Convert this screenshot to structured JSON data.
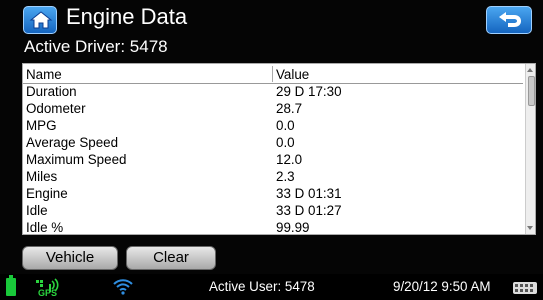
{
  "header": {
    "title": "Engine Data",
    "subtitle": "Active Driver: 5478"
  },
  "table": {
    "columns": [
      "Name",
      "Value"
    ],
    "rows": [
      {
        "name": "Duration",
        "value": "29 D 17:30"
      },
      {
        "name": "Odometer",
        "value": "28.7"
      },
      {
        "name": "MPG",
        "value": "0.0"
      },
      {
        "name": "Average Speed",
        "value": "0.0"
      },
      {
        "name": "Maximum Speed",
        "value": "12.0"
      },
      {
        "name": "Miles",
        "value": "2.3"
      },
      {
        "name": "Engine",
        "value": "33 D 01:31"
      },
      {
        "name": "Idle",
        "value": "33 D 01:27"
      },
      {
        "name": "Idle %",
        "value": "99.99"
      }
    ]
  },
  "buttons": {
    "vehicle": "Vehicle",
    "clear": "Clear"
  },
  "status": {
    "gps_label": "GPS",
    "active_user": "Active User: 5478",
    "datetime": "9/20/12 9:50 AM"
  },
  "colors": {
    "accent_blue": "#2f8ee0",
    "battery_green": "#19c93a"
  },
  "icons": [
    "home-icon",
    "back-arrow-icon",
    "battery-icon",
    "gps-signal-icon",
    "wifi-icon",
    "keyboard-icon"
  ]
}
